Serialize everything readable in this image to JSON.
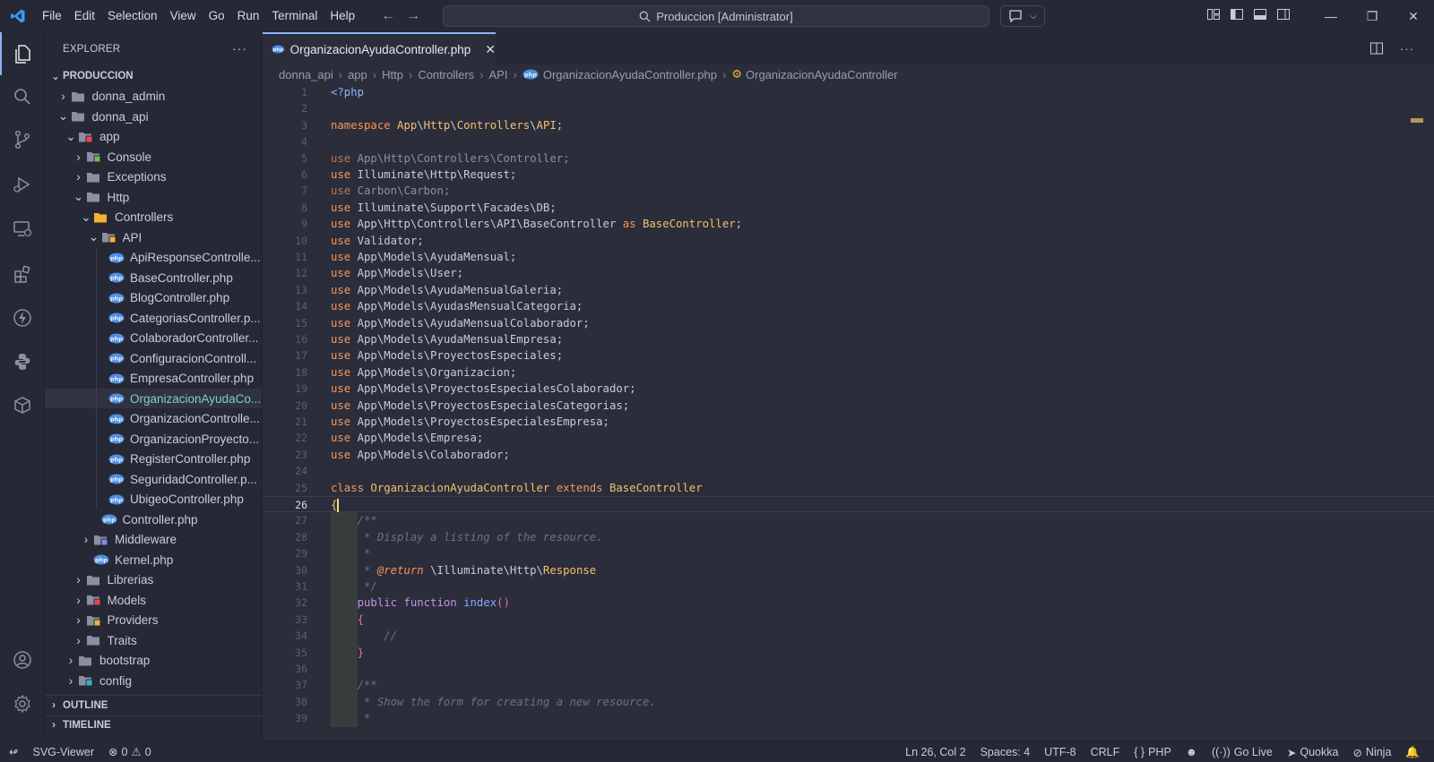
{
  "titlebar": {
    "menu": [
      "File",
      "Edit",
      "Selection",
      "View",
      "Go",
      "Run",
      "Terminal",
      "Help"
    ],
    "command_center": "Produccion [Administrator]"
  },
  "explorer": {
    "title": "EXPLORER",
    "root": "PRODUCCION",
    "items": [
      {
        "label": "donna_admin",
        "depth": 1,
        "kind": "folder",
        "open": false
      },
      {
        "label": "donna_api",
        "depth": 1,
        "kind": "folder",
        "open": true
      },
      {
        "label": "app",
        "depth": 2,
        "kind": "folder-app",
        "open": true
      },
      {
        "label": "Console",
        "depth": 3,
        "kind": "folder-console",
        "open": false
      },
      {
        "label": "Exceptions",
        "depth": 3,
        "kind": "folder",
        "open": false
      },
      {
        "label": "Http",
        "depth": 3,
        "kind": "folder",
        "open": true
      },
      {
        "label": "Controllers",
        "depth": 4,
        "kind": "folder-controllers",
        "open": true
      },
      {
        "label": "API",
        "depth": 5,
        "kind": "folder-api",
        "open": true
      },
      {
        "label": "ApiResponseControlle...",
        "depth": 6,
        "kind": "php"
      },
      {
        "label": "BaseController.php",
        "depth": 6,
        "kind": "php"
      },
      {
        "label": "BlogController.php",
        "depth": 6,
        "kind": "php"
      },
      {
        "label": "CategoriasController.p...",
        "depth": 6,
        "kind": "php"
      },
      {
        "label": "ColaboradorController...",
        "depth": 6,
        "kind": "php"
      },
      {
        "label": "ConfiguracionControll...",
        "depth": 6,
        "kind": "php"
      },
      {
        "label": "EmpresaController.php",
        "depth": 6,
        "kind": "php"
      },
      {
        "label": "OrganizacionAyudaCo...",
        "depth": 6,
        "kind": "php",
        "selected": true
      },
      {
        "label": "OrganizacionControlle...",
        "depth": 6,
        "kind": "php"
      },
      {
        "label": "OrganizacionProyecto...",
        "depth": 6,
        "kind": "php"
      },
      {
        "label": "RegisterController.php",
        "depth": 6,
        "kind": "php"
      },
      {
        "label": "SeguridadController.p...",
        "depth": 6,
        "kind": "php"
      },
      {
        "label": "UbigeoController.php",
        "depth": 6,
        "kind": "php"
      },
      {
        "label": "Controller.php",
        "depth": 5,
        "kind": "php"
      },
      {
        "label": "Middleware",
        "depth": 4,
        "kind": "folder-middleware",
        "open": false
      },
      {
        "label": "Kernel.php",
        "depth": 4,
        "kind": "php"
      },
      {
        "label": "Librerias",
        "depth": 3,
        "kind": "folder",
        "open": false
      },
      {
        "label": "Models",
        "depth": 3,
        "kind": "folder-models",
        "open": false
      },
      {
        "label": "Providers",
        "depth": 3,
        "kind": "folder-providers",
        "open": false
      },
      {
        "label": "Traits",
        "depth": 3,
        "kind": "folder",
        "open": false
      },
      {
        "label": "bootstrap",
        "depth": 2,
        "kind": "folder",
        "open": false
      },
      {
        "label": "config",
        "depth": 2,
        "kind": "folder-config",
        "open": false
      }
    ],
    "outline": "OUTLINE",
    "timeline": "TIMELINE"
  },
  "editor": {
    "tab_label": "OrganizacionAyudaController.php",
    "breadcrumbs": [
      "donna_api",
      "app",
      "Http",
      "Controllers",
      "API",
      "OrganizacionAyudaController.php",
      "OrganizacionAyudaController"
    ],
    "current_line": 26,
    "lines": [
      [
        [
          "php",
          "<?php"
        ]
      ],
      [],
      [
        [
          "kw",
          "namespace "
        ],
        [
          "cls",
          "App"
        ],
        [
          "ns",
          "\\"
        ],
        [
          "cls",
          "Http"
        ],
        [
          "ns",
          "\\"
        ],
        [
          "cls",
          "Controllers"
        ],
        [
          "ns",
          "\\"
        ],
        [
          "cls",
          "API"
        ],
        [
          "ns",
          ";"
        ]
      ],
      [],
      [
        [
          "kwd",
          "use "
        ],
        [
          "dim",
          "App\\Http\\Controllers\\Controller;"
        ]
      ],
      [
        [
          "kw",
          "use "
        ],
        [
          "ns",
          "Illuminate\\Http\\Request;"
        ]
      ],
      [
        [
          "kwd",
          "use "
        ],
        [
          "dim",
          "Carbon\\Carbon;"
        ]
      ],
      [
        [
          "kw",
          "use "
        ],
        [
          "ns",
          "Illuminate\\Support\\Facades\\DB;"
        ]
      ],
      [
        [
          "kw",
          "use "
        ],
        [
          "ns",
          "App\\Http\\Controllers\\API\\BaseController "
        ],
        [
          "kw",
          "as "
        ],
        [
          "cls",
          "BaseController"
        ],
        [
          "ns",
          ";"
        ]
      ],
      [
        [
          "kw",
          "use "
        ],
        [
          "ns",
          "Validator;"
        ]
      ],
      [
        [
          "kw",
          "use "
        ],
        [
          "ns",
          "App\\Models\\AyudaMensual;"
        ]
      ],
      [
        [
          "kw",
          "use "
        ],
        [
          "ns",
          "App\\Models\\User;"
        ]
      ],
      [
        [
          "kw",
          "use "
        ],
        [
          "ns",
          "App\\Models\\AyudaMensualGaleria;"
        ]
      ],
      [
        [
          "kw",
          "use "
        ],
        [
          "ns",
          "App\\Models\\AyudasMensualCategoria;"
        ]
      ],
      [
        [
          "kw",
          "use "
        ],
        [
          "ns",
          "App\\Models\\AyudaMensualColaborador;"
        ]
      ],
      [
        [
          "kw",
          "use "
        ],
        [
          "ns",
          "App\\Models\\AyudaMensualEmpresa;"
        ]
      ],
      [
        [
          "kw",
          "use "
        ],
        [
          "ns",
          "App\\Models\\ProyectosEspeciales;"
        ]
      ],
      [
        [
          "kw",
          "use "
        ],
        [
          "ns",
          "App\\Models\\Organizacion;"
        ]
      ],
      [
        [
          "kw",
          "use "
        ],
        [
          "ns",
          "App\\Models\\ProyectosEspecialesColaborador;"
        ]
      ],
      [
        [
          "kw",
          "use "
        ],
        [
          "ns",
          "App\\Models\\ProyectosEspecialesCategorias;"
        ]
      ],
      [
        [
          "kw",
          "use "
        ],
        [
          "ns",
          "App\\Models\\ProyectosEspecialesEmpresa;"
        ]
      ],
      [
        [
          "kw",
          "use "
        ],
        [
          "ns",
          "App\\Models\\Empresa;"
        ]
      ],
      [
        [
          "kw",
          "use "
        ],
        [
          "ns",
          "App\\Models\\Colaborador;"
        ]
      ],
      [],
      [
        [
          "kw",
          "class "
        ],
        [
          "cls",
          "OrganizacionAyudaController "
        ],
        [
          "kw",
          "extends "
        ],
        [
          "cls",
          "BaseController"
        ]
      ],
      [
        [
          "br",
          "{"
        ],
        [
          "cursor",
          ""
        ]
      ],
      [
        [
          "cm",
          "    /**"
        ]
      ],
      [
        [
          "cm",
          "     * Display a listing of the resource."
        ]
      ],
      [
        [
          "cm",
          "     *"
        ]
      ],
      [
        [
          "cm",
          "     * "
        ],
        [
          "doc",
          "@return "
        ],
        [
          "ns",
          "\\Illuminate\\Http\\"
        ],
        [
          "cls",
          "Response"
        ]
      ],
      [
        [
          "cm",
          "     */"
        ]
      ],
      [
        [
          "kw2",
          "    public function "
        ],
        [
          "fn",
          "index"
        ],
        [
          "br2",
          "()"
        ]
      ],
      [
        [
          "br2",
          "    {"
        ]
      ],
      [
        [
          "cm",
          "        //"
        ]
      ],
      [
        [
          "br2",
          "    }"
        ]
      ],
      [],
      [
        [
          "cm",
          "    /**"
        ]
      ],
      [
        [
          "cm",
          "     * Show the form for creating a new resource."
        ]
      ],
      [
        [
          "cm",
          "     *"
        ]
      ]
    ]
  },
  "statusbar": {
    "remote": "SVG-Viewer",
    "errors": "0",
    "warnings": "0",
    "position": "Ln 26, Col 2",
    "spaces": "Spaces: 4",
    "encoding": "UTF-8",
    "eol": "CRLF",
    "language": "PHP",
    "golive": "Go Live",
    "quokka": "Quokka",
    "ninja": "Ninja"
  },
  "colors": {
    "accent": "#8ab4f8",
    "keyword": "#f7965b",
    "class": "#f5c16c",
    "selected_text": "#7fd1c3"
  }
}
